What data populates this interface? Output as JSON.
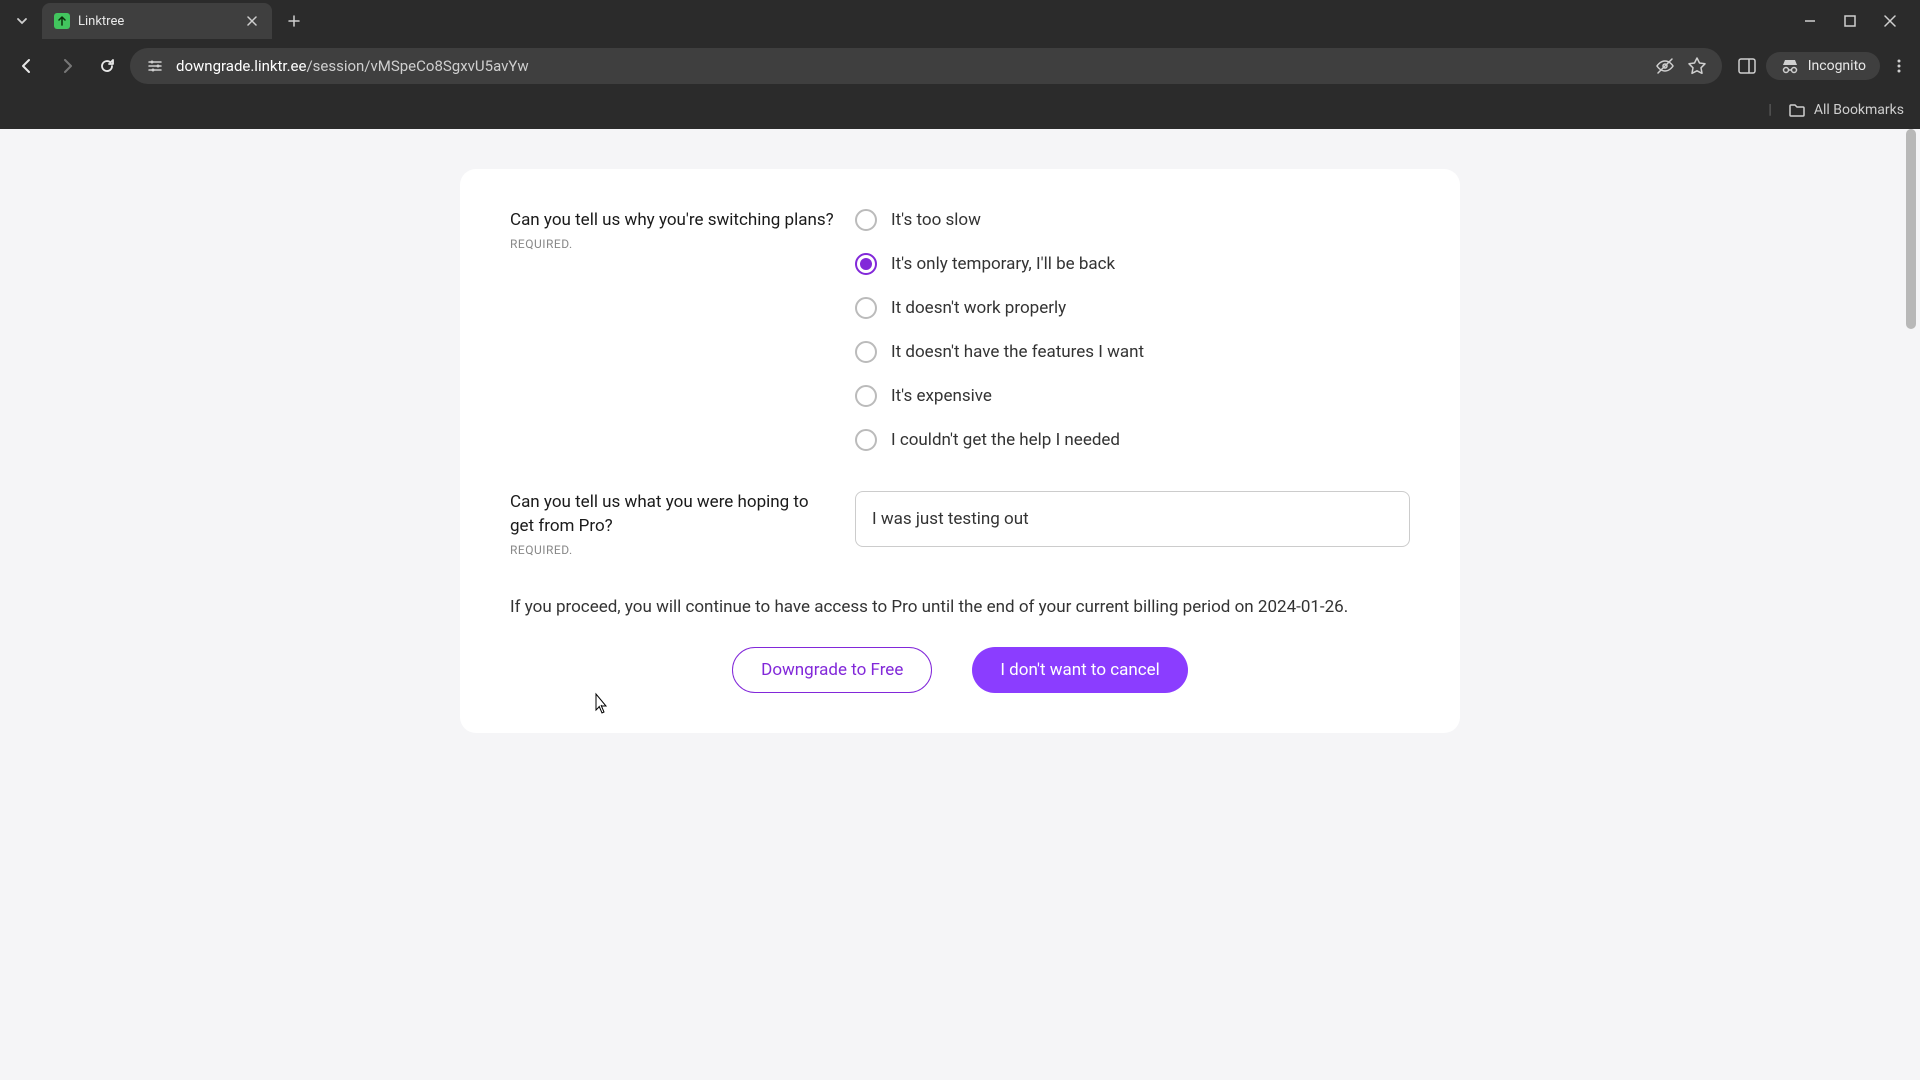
{
  "browser": {
    "tab_title": "Linktree",
    "url_domain": "downgrade.linktr.ee",
    "url_path": "/session/vMSpeCo8SgxvU5avYw",
    "incognito_label": "Incognito",
    "all_bookmarks": "All Bookmarks"
  },
  "form": {
    "q1": {
      "label": "Can you tell us why you're switching plans?",
      "required": "REQUIRED.",
      "options": [
        "It's too slow",
        "It's only temporary, I'll be back",
        "It doesn't work properly",
        "It doesn't have the features I want",
        "It's expensive",
        "I couldn't get the help I needed"
      ],
      "selected_index": 1
    },
    "q2": {
      "label": "Can you tell us what you were hoping to get from Pro?",
      "required": "REQUIRED.",
      "value": "I was just testing out"
    },
    "notice": "If you proceed, you will continue to have access to Pro until the end of your current billing period on 2024-01-26.",
    "downgrade_btn": "Downgrade to Free",
    "cancel_btn": "I don't want to cancel"
  }
}
